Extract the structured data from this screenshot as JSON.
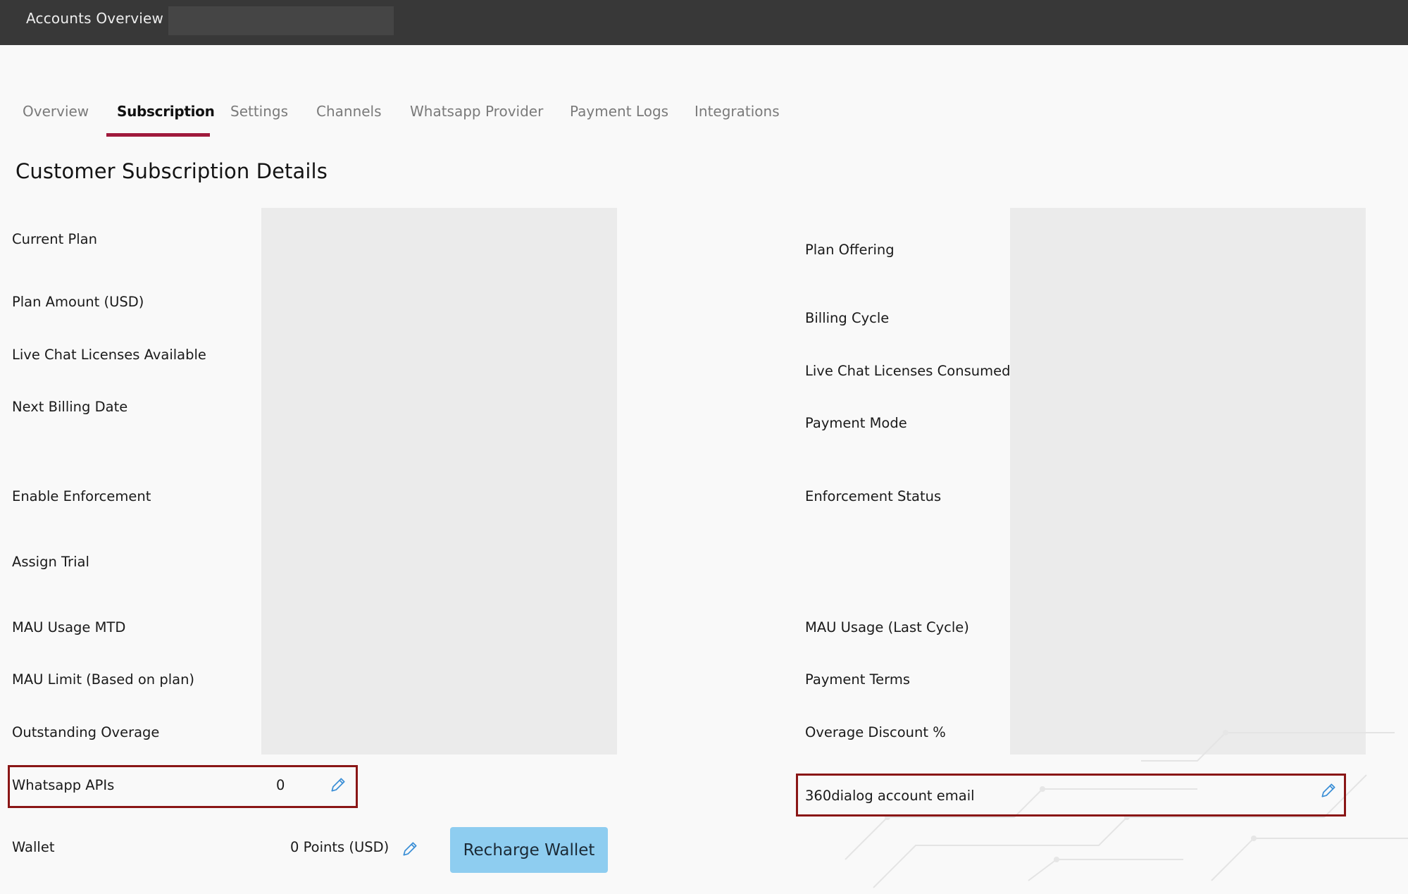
{
  "header": {
    "breadcrumb_root": "Accounts Overview",
    "breadcrumb_separator": "/"
  },
  "tabs": [
    {
      "label": "Overview",
      "active": false
    },
    {
      "label": "Subscription",
      "active": true
    },
    {
      "label": "Settings",
      "active": false
    },
    {
      "label": "Channels",
      "active": false
    },
    {
      "label": "Whatsapp Provider",
      "active": false
    },
    {
      "label": "Payment Logs",
      "active": false
    },
    {
      "label": "Integrations",
      "active": false
    }
  ],
  "section": {
    "title": "Customer Subscription Details"
  },
  "left_fields": [
    "Current Plan",
    "Plan Amount (USD)",
    "Live Chat Licenses Available",
    "Next Billing Date",
    "Enable Enforcement",
    "Assign Trial",
    "MAU Usage MTD",
    "MAU Limit (Based on plan)",
    "Outstanding Overage"
  ],
  "right_fields": [
    "Plan Offering",
    "Billing Cycle",
    "Live Chat Licenses Consumed",
    "Payment Mode",
    "Enforcement Status",
    "MAU Usage (Last Cycle)",
    "Payment Terms",
    "Overage Discount %"
  ],
  "whatsapp_apis": {
    "label": "Whatsapp APIs",
    "value": "0"
  },
  "dialog_email": {
    "label": "360dialog account email",
    "value": ""
  },
  "wallet": {
    "label": "Wallet",
    "value": "0 Points (USD)",
    "recharge_label": "Recharge Wallet"
  },
  "colors": {
    "topbar": "#383838",
    "active_tab_underline": "#a01a3c",
    "highlight_border": "#8a1616",
    "recharge_button": "#8ecdf0",
    "edit_icon": "#3b8fd6",
    "redacted": "#ebebeb"
  },
  "icons": {
    "edit": "pencil-icon"
  }
}
